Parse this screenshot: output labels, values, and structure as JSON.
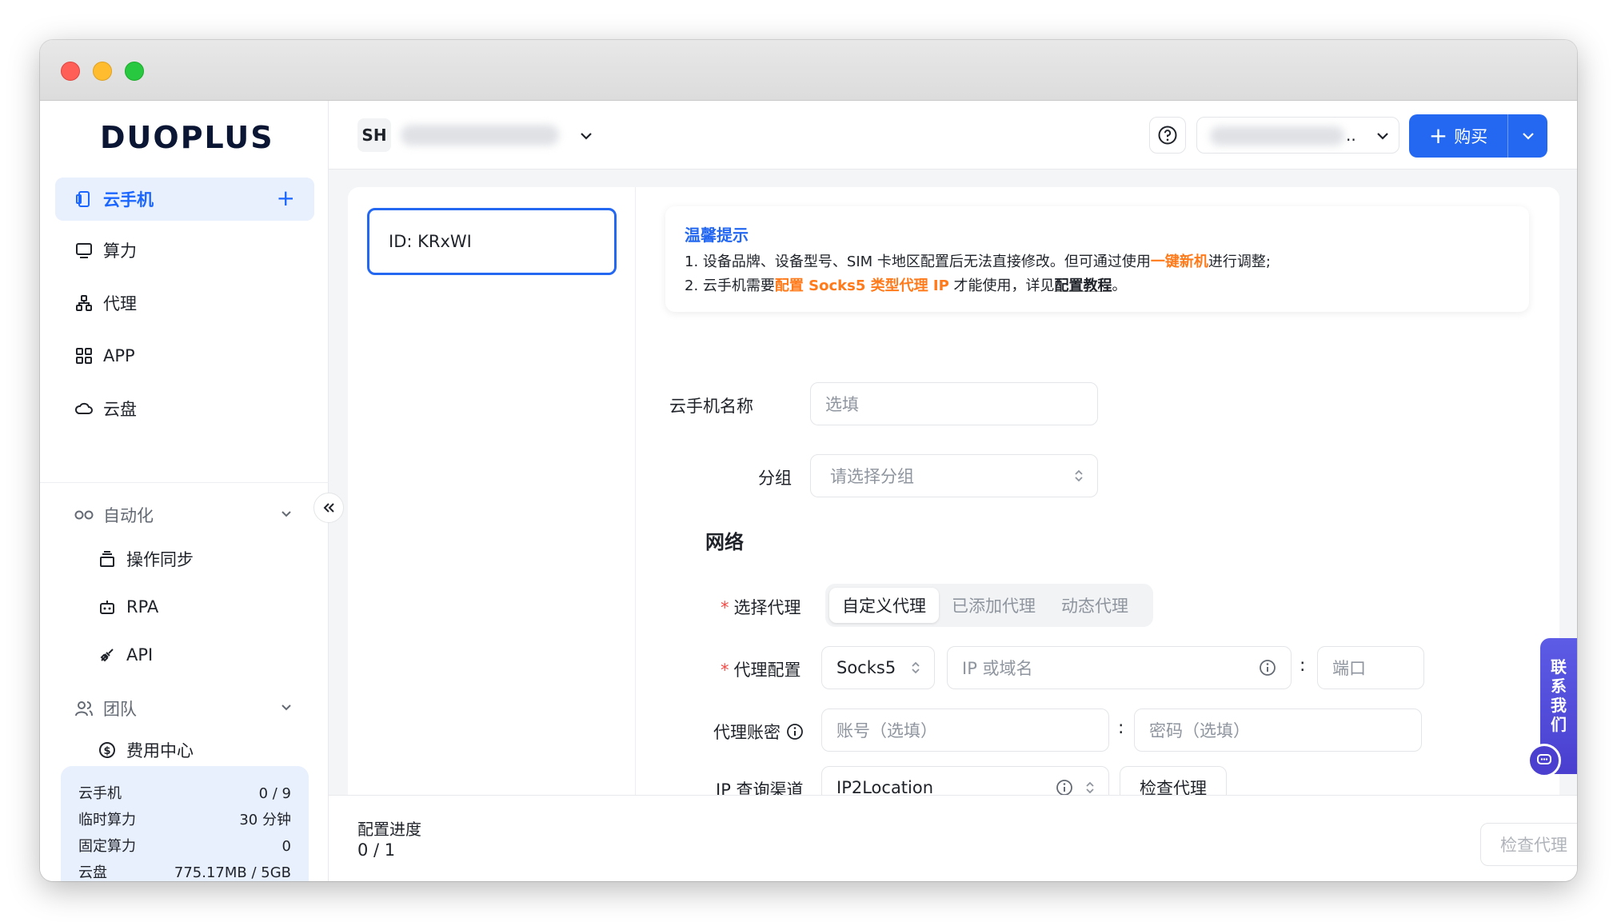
{
  "app": {
    "logo_text": "DUOPLUS"
  },
  "sidebar": {
    "nav": [
      {
        "label": "云手机",
        "icon": "phone-icon"
      },
      {
        "label": "算力",
        "icon": "monitor-icon"
      },
      {
        "label": "代理",
        "icon": "network-icon"
      },
      {
        "label": "APP",
        "icon": "apps-grid-icon"
      },
      {
        "label": "云盘",
        "icon": "cloud-icon"
      }
    ],
    "automation": {
      "label": "自动化",
      "items": [
        {
          "label": "操作同步",
          "icon": "sync-stack-icon"
        },
        {
          "label": "RPA",
          "icon": "robot-icon"
        },
        {
          "label": "API",
          "icon": "plug-icon"
        }
      ]
    },
    "team": {
      "label": "团队",
      "items": [
        {
          "label": "费用中心",
          "icon": "dollar-circle-icon"
        }
      ]
    },
    "quota": [
      {
        "label": "云手机",
        "value": "0 / 9"
      },
      {
        "label": "临时算力",
        "value": "30 分钟"
      },
      {
        "label": "固定算力",
        "value": "0"
      },
      {
        "label": "云盘",
        "value": "775.17MB / 5GB"
      }
    ]
  },
  "header": {
    "workspace_badge": "SH",
    "account_dots": "..",
    "buy_label": "购买",
    "buy_plus": "+"
  },
  "device": {
    "id_label": "ID: KRxWI"
  },
  "notice": {
    "title": "温馨提示",
    "line1_prefix": "1. 设备品牌、设备型号、SIM 卡地区配置后无法直接修改。但可通过使用",
    "line1_highlight": "一键新机",
    "line1_suffix": "进行调整;",
    "line2_prefix": "2. 云手机需要",
    "line2_highlight": "配置 Socks5 类型代理 IP",
    "line2_mid": " 才能使用，详见",
    "line2_link": "配置教程",
    "line2_suffix": "。"
  },
  "form": {
    "name_label": "云手机名称",
    "name_placeholder": "选填",
    "group_label": "分组",
    "group_placeholder": "请选择分组",
    "network_title": "网络",
    "proxy_select_label": "选择代理",
    "proxy_tabs": [
      "自定义代理",
      "已添加代理",
      "动态代理"
    ],
    "proxy_config_label": "代理配置",
    "proxy_type": "Socks5",
    "host_placeholder": "IP 或域名",
    "port_placeholder": "端口",
    "account_label": "代理账密",
    "username_placeholder": "账号（选填）",
    "password_placeholder": "密码（选填）",
    "ip_query_label": "IP 查询渠道",
    "ip_query_value": "IP2Location",
    "check_proxy_label": "检查代理",
    "colon": ":"
  },
  "footer": {
    "progress_label": "配置进度",
    "progress_value": "0 / 1",
    "check_button": "检查代理"
  },
  "contact": {
    "label": "联系我们"
  },
  "colors": {
    "accent": "#2468f2",
    "highlight": "#ff7a1a",
    "contact": "#4a3fcf"
  }
}
